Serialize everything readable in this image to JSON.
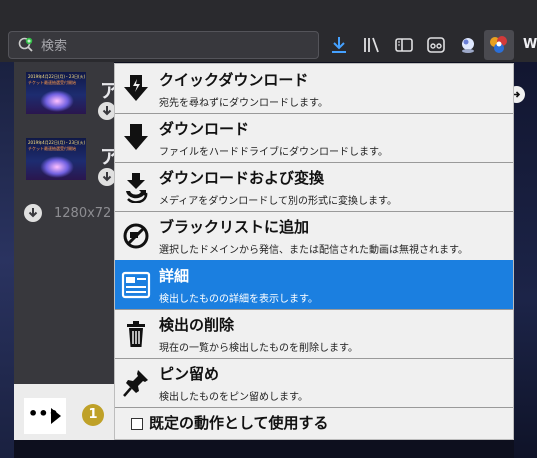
{
  "toolbar": {
    "search_placeholder": "検索",
    "icons": [
      "search-icon",
      "download-icon",
      "library-icon",
      "sidebar-icon",
      "reader-icon",
      "globe-icon",
      "extension-icon"
    ],
    "overflow_letter": "W"
  },
  "panel": {
    "videos": [
      {
        "thumb_line1": "2019年4月22日(月)・23日(火)",
        "thumb_line2": "チケット最速抽選受付開始",
        "title_char": "ア"
      },
      {
        "thumb_line1": "2019年4月22日(月)・23日(火)",
        "thumb_line2": "チケット最速抽選受付開始",
        "title_char": "ア"
      }
    ],
    "resolution": "1280x72",
    "more_label": "•••",
    "badge_count": "1"
  },
  "menu": {
    "items": [
      {
        "title": "クイックダウンロード",
        "desc": "宛先を尋ねずにダウンロードします。",
        "icon": "quick-download-icon"
      },
      {
        "title": "ダウンロード",
        "desc": "ファイルをハードドライブにダウンロードします。",
        "icon": "download-arrow-icon"
      },
      {
        "title": "ダウンロードおよび変換",
        "desc": "メディアをダウンロードして別の形式に変換します。",
        "icon": "download-convert-icon"
      },
      {
        "title": "ブラックリストに追加",
        "desc": "選択したドメインから発信、または配信された動画は無視されます。",
        "icon": "blacklist-icon"
      },
      {
        "title": "詳細",
        "desc": "検出したものの詳細を表示します。",
        "icon": "details-icon"
      },
      {
        "title": "検出の削除",
        "desc": "現在の一覧から検出したものを削除します。",
        "icon": "trash-icon"
      },
      {
        "title": "ピン留め",
        "desc": "検出したものをピン留めします。",
        "icon": "pin-icon"
      }
    ],
    "default_checkbox_label": "既定の動作として使用する",
    "highlight_color": "#1b7fe0"
  }
}
